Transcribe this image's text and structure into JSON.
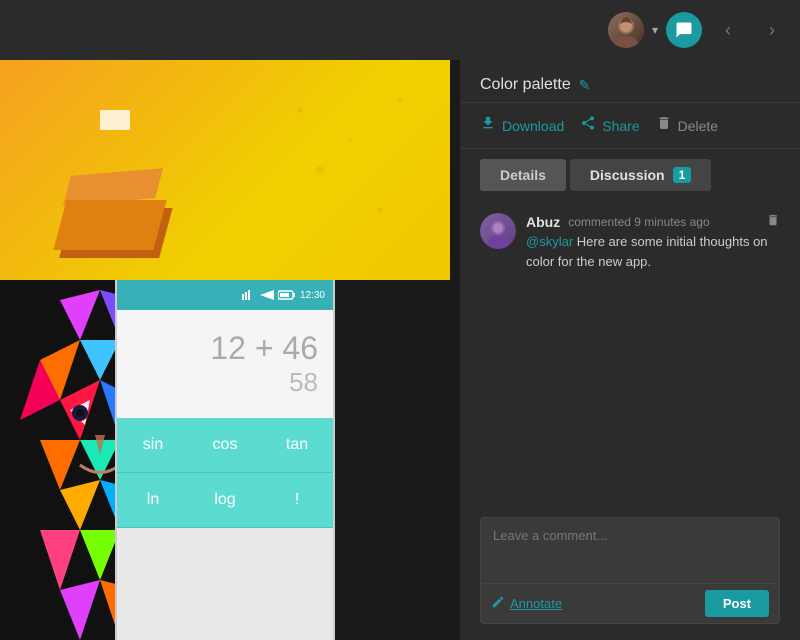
{
  "nav": {
    "avatar_label": "User avatar",
    "chevron": "▾",
    "comment_icon": "💬",
    "prev_icon": "‹",
    "next_icon": "›"
  },
  "sidebar": {
    "title": "Color palette",
    "edit_icon": "✎",
    "actions": {
      "download": "Download",
      "share": "Share",
      "delete": "Delete"
    },
    "tabs": {
      "details": "Details",
      "discussion": "Discussion",
      "discussion_count": "1"
    },
    "comment": {
      "author": "Abuz",
      "meta": "commented 9 minutes ago",
      "mention": "@skylar",
      "text": " Here are some initial thoughts on color for the new app.",
      "placeholder": "Leave a comment...",
      "annotate": "Annotate",
      "post": "Post"
    }
  },
  "phone": {
    "time": "12:30",
    "expression": "12 + 46",
    "result": "58",
    "buttons": [
      "sin",
      "cos",
      "tan",
      "ln",
      "log",
      "!"
    ]
  }
}
